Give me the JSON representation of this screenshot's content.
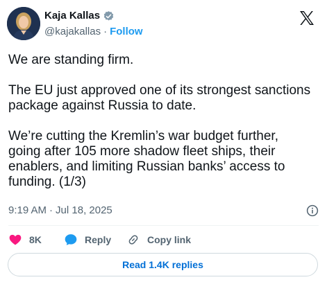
{
  "author": {
    "name": "Kaja Kallas",
    "handle": "@kajakallas",
    "separator": "·",
    "follow_label": "Follow"
  },
  "post": {
    "paragraphs": [
      "We are standing firm.",
      "The EU just approved one of its strongest sanctions package against Russia to date.",
      "We’re cutting the Kremlin’s war budget further, going after 105 more shadow fleet ships, their enablers, and limiting Russian banks’ access to funding. (1/3)"
    ],
    "time": "9:19 AM",
    "separator": "·",
    "date": "Jul 18, 2025"
  },
  "actions": {
    "likes": "8K",
    "reply_label": "Reply",
    "copy_label": "Copy link"
  },
  "read_replies_label": "Read 1.4K replies",
  "icons": [
    "x-logo-icon",
    "verified-badge-icon",
    "info-icon",
    "heart-icon",
    "reply-bubble-icon",
    "link-icon"
  ],
  "colors": {
    "accent": "#1d9bf0",
    "like": "#f91880",
    "muted": "#536471",
    "text": "#0f1419",
    "replies_text": "#006fd6"
  }
}
